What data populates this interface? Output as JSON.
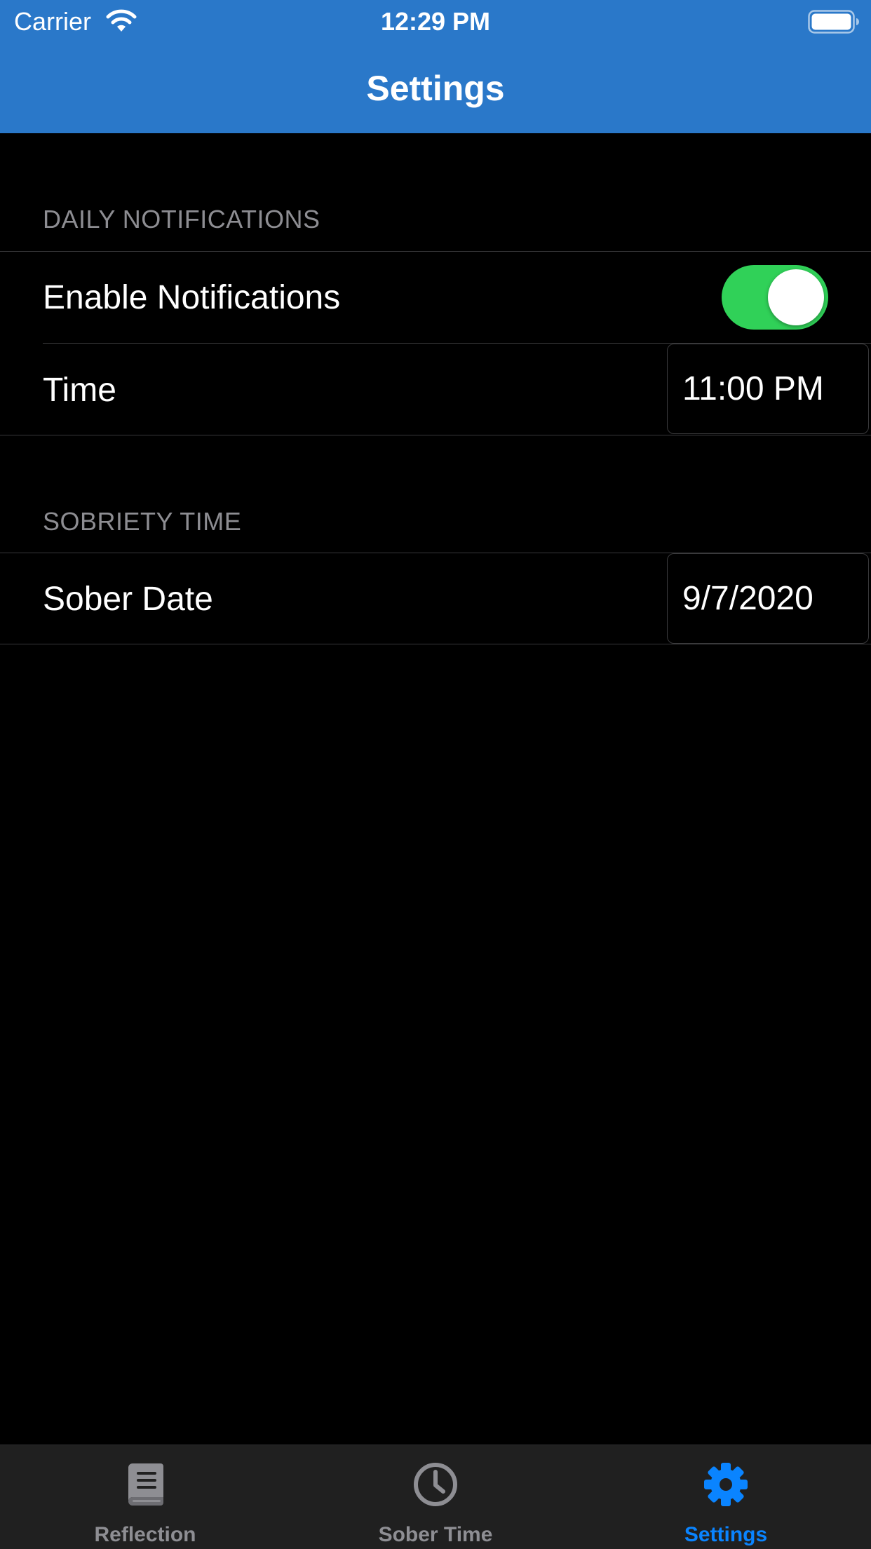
{
  "status_bar": {
    "carrier": "Carrier",
    "time": "12:29 PM",
    "wifi_icon": "wifi-icon",
    "battery_icon": "battery-icon"
  },
  "nav": {
    "title": "Settings"
  },
  "colors": {
    "nav_background": "#2a78c9",
    "toggle_on": "#30d158",
    "tab_active": "#0a84ff",
    "tab_inactive": "#8e8e93",
    "page_background": "#000000"
  },
  "sections": {
    "notifications": {
      "header": "DAILY NOTIFICATIONS",
      "enable_label": "Enable Notifications",
      "enabled": true,
      "time_label": "Time",
      "time_value": "11:00 PM"
    },
    "sobriety": {
      "header": "SOBRIETY TIME",
      "date_label": "Sober Date",
      "date_value": "9/7/2020"
    }
  },
  "tabs": [
    {
      "label": "Reflection",
      "icon": "book-icon",
      "active": false
    },
    {
      "label": "Sober Time",
      "icon": "clock-icon",
      "active": false
    },
    {
      "label": "Settings",
      "icon": "gear-icon",
      "active": true
    }
  ]
}
